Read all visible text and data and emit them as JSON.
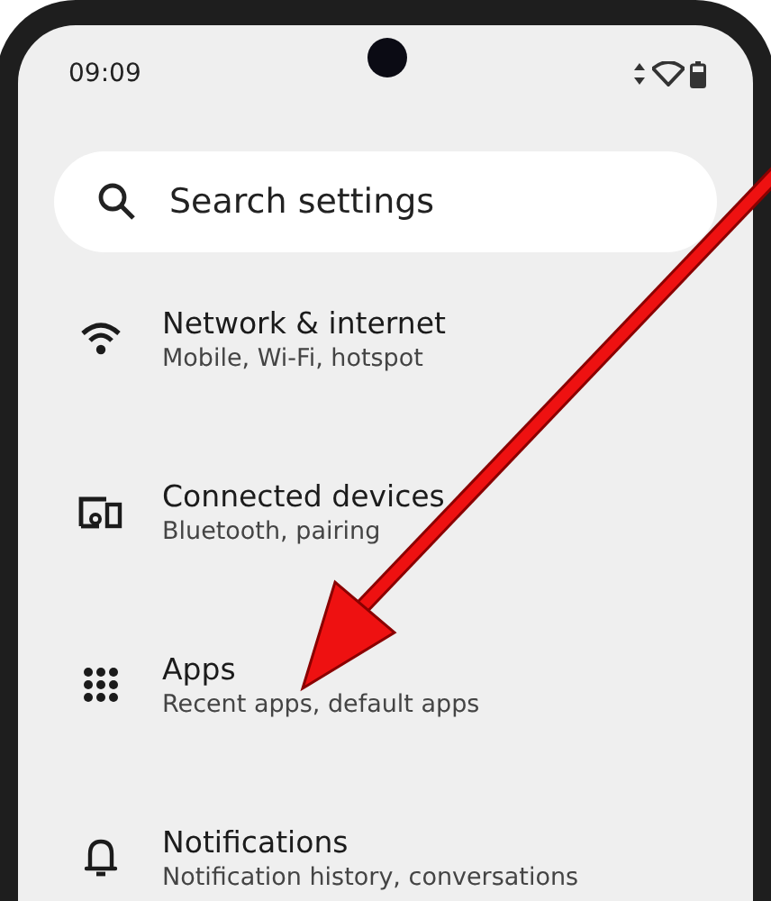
{
  "status_bar": {
    "time": "09:09"
  },
  "search": {
    "placeholder": "Search settings"
  },
  "items": [
    {
      "title": "Network & internet",
      "subtitle": "Mobile, Wi-Fi, hotspot"
    },
    {
      "title": "Connected devices",
      "subtitle": "Bluetooth, pairing"
    },
    {
      "title": "Apps",
      "subtitle": "Recent apps, default apps"
    },
    {
      "title": "Notifications",
      "subtitle": "Notification history, conversations"
    }
  ]
}
